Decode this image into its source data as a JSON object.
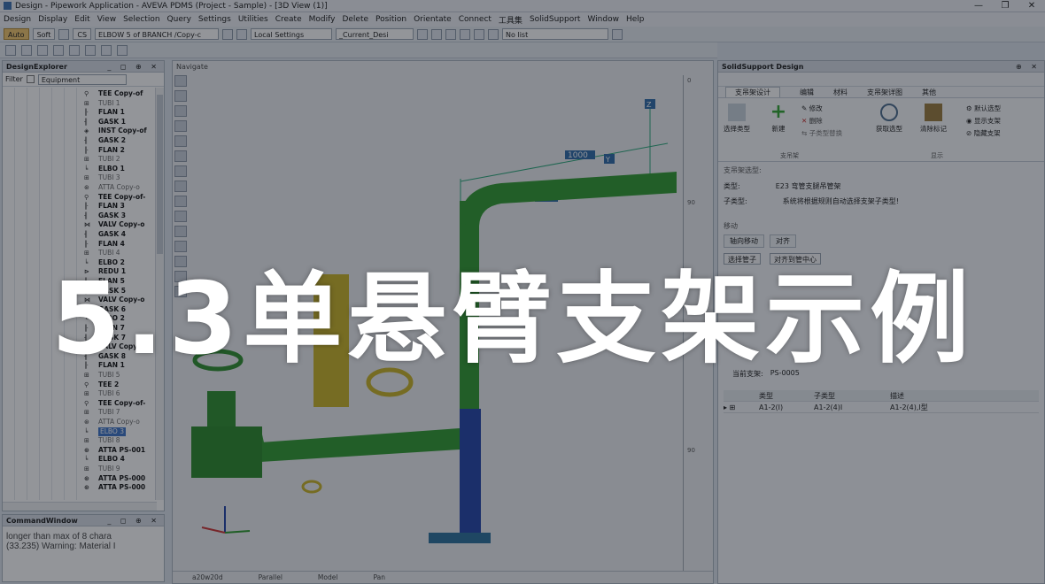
{
  "window": {
    "title": "Design - Pipework Application - AVEVA PDMS (Project - Sample) - [3D View (1)]",
    "controls": [
      "—",
      "❐",
      "✕"
    ]
  },
  "menu": [
    "Design",
    "Display",
    "Edit",
    "View",
    "Selection",
    "Query",
    "Settings",
    "Utilities",
    "Create",
    "Modify",
    "Delete",
    "Position",
    "Orientate",
    "Connect",
    "工具集",
    "SolidSupport",
    "Window",
    "Help"
  ],
  "toolbar": {
    "auto_label": "Auto",
    "soft_label": "Soft",
    "cs_label": "CS",
    "element_select": "ELBOW 5 of BRANCH /Copy-c",
    "settings_select": "Local Settings",
    "design_select": "_Current_Desi",
    "list_select": "No list"
  },
  "explorer": {
    "title": "DesignExplorer",
    "filter_label": "Filter",
    "filter_value": "Equipment",
    "items": [
      {
        "icon": "⚲",
        "label": "TEE Copy-of",
        "style": "b"
      },
      {
        "icon": "⊞",
        "label": "TUBI 1",
        "style": "g"
      },
      {
        "icon": "╟",
        "label": "FLAN 1",
        "style": "b"
      },
      {
        "icon": "╢",
        "label": "GASK 1",
        "style": "b"
      },
      {
        "icon": "◈",
        "label": "INST Copy-of",
        "style": "b"
      },
      {
        "icon": "╢",
        "label": "GASK 2",
        "style": "b"
      },
      {
        "icon": "╟",
        "label": "FLAN 2",
        "style": "b"
      },
      {
        "icon": "⊞",
        "label": "TUBI 2",
        "style": "g"
      },
      {
        "icon": "╘",
        "label": "ELBO 1",
        "style": "b"
      },
      {
        "icon": "⊞",
        "label": "TUBI 3",
        "style": "g"
      },
      {
        "icon": "⊛",
        "label": "ATTA Copy-o",
        "style": "g"
      },
      {
        "icon": "⚲",
        "label": "TEE Copy-of-",
        "style": "b"
      },
      {
        "icon": "╟",
        "label": "FLAN 3",
        "style": "b"
      },
      {
        "icon": "╢",
        "label": "GASK 3",
        "style": "b"
      },
      {
        "icon": "⋈",
        "label": "VALV Copy-o",
        "style": "b"
      },
      {
        "icon": "╢",
        "label": "GASK 4",
        "style": "b"
      },
      {
        "icon": "╟",
        "label": "FLAN 4",
        "style": "b"
      },
      {
        "icon": "⊞",
        "label": "TUBI 4",
        "style": "g"
      },
      {
        "icon": "╘",
        "label": "ELBO 2",
        "style": "b"
      },
      {
        "icon": "⊳",
        "label": "REDU 1",
        "style": "b"
      },
      {
        "icon": "╟",
        "label": "FLAN 5",
        "style": "b"
      },
      {
        "icon": "╢",
        "label": "GASK 5",
        "style": "b"
      },
      {
        "icon": "⋈",
        "label": "VALV Copy-o",
        "style": "b"
      },
      {
        "icon": "╢",
        "label": "GASK 6",
        "style": "b"
      },
      {
        "icon": "╘",
        "label": "ELBO 2",
        "style": "b"
      },
      {
        "icon": "╟",
        "label": "FLAN 7",
        "style": "b"
      },
      {
        "icon": "╢",
        "label": "GASK 7",
        "style": "b"
      },
      {
        "icon": "⋈",
        "label": "VALV Copy-o",
        "style": "b"
      },
      {
        "icon": "╢",
        "label": "GASK 8",
        "style": "b"
      },
      {
        "icon": "╟",
        "label": "FLAN 1",
        "style": "b"
      },
      {
        "icon": "⊞",
        "label": "TUBI 5",
        "style": "g"
      },
      {
        "icon": "⚲",
        "label": "TEE 2",
        "style": "b"
      },
      {
        "icon": "⊞",
        "label": "TUBI 6",
        "style": "g"
      },
      {
        "icon": "⚲",
        "label": "TEE Copy-of-",
        "style": "b"
      },
      {
        "icon": "⊞",
        "label": "TUBI 7",
        "style": "g"
      },
      {
        "icon": "⊛",
        "label": "ATTA Copy-o",
        "style": "g"
      },
      {
        "icon": "╘",
        "label": "ELBO 3",
        "style": "sel"
      },
      {
        "icon": "⊞",
        "label": "TUBI 8",
        "style": "g"
      },
      {
        "icon": "⊛",
        "label": "ATTA PS-001",
        "style": "b"
      },
      {
        "icon": "╘",
        "label": "ELBO 4",
        "style": "b"
      },
      {
        "icon": "⊞",
        "label": "TUBI 9",
        "style": "g"
      },
      {
        "icon": "⊛",
        "label": "ATTA PS-000",
        "style": "b"
      },
      {
        "icon": "⊛",
        "label": "ATTA PS-000",
        "style": "b"
      }
    ]
  },
  "command_window": {
    "title": "CommandWindow",
    "lines": [
      "longer than max of 8 chara",
      "(33.235) Warning: Material I"
    ]
  },
  "navigate": {
    "title": "Navigate",
    "ruler": [
      "0",
      "90",
      "90",
      "90"
    ],
    "status": [
      "a20w20d",
      "Parallel",
      "Model",
      "Pan"
    ],
    "dim_label": "1000",
    "axis_labels": [
      "Z",
      "Y"
    ]
  },
  "solid_support": {
    "title": "SolidSupport Design",
    "tabs": [
      "支吊架设计",
      "编辑",
      "材料",
      "支吊架详图",
      "其他"
    ],
    "ribbon": {
      "select_type": "选择类型",
      "new": "新建",
      "modify": "修改",
      "delete": "删除",
      "sub_type_replace": "子类型替换",
      "group_support": "支吊架",
      "get_selection": "获取选型",
      "clear_mark": "清除标记",
      "default_selection": "默认选型",
      "show_support": "显示支架",
      "hide_support": "隐藏支架",
      "group_display": "显示"
    },
    "selection_section": "支吊架选型:",
    "type_label": "类型:",
    "type_value": "E23  弯管支腿吊管架",
    "subtype_label": "子类型:",
    "subtype_value": "系统将根据规则自动选择支架子类型!",
    "move_section": "移动",
    "move_tabs": [
      "轴向移动",
      "对齐"
    ],
    "align_pipe_button": "选择管子",
    "align_center_button": "对齐到管中心",
    "current_support_label": "当前支架:",
    "current_support_value": "PS-0005",
    "table_headers": [
      "类型",
      "子类型",
      "描述"
    ],
    "table_rows": [
      [
        "A1-2(I)",
        "A1-2(4)I",
        "A1-2(4),I型"
      ]
    ]
  },
  "overlay_title": "5.3单悬臂支架示例"
}
